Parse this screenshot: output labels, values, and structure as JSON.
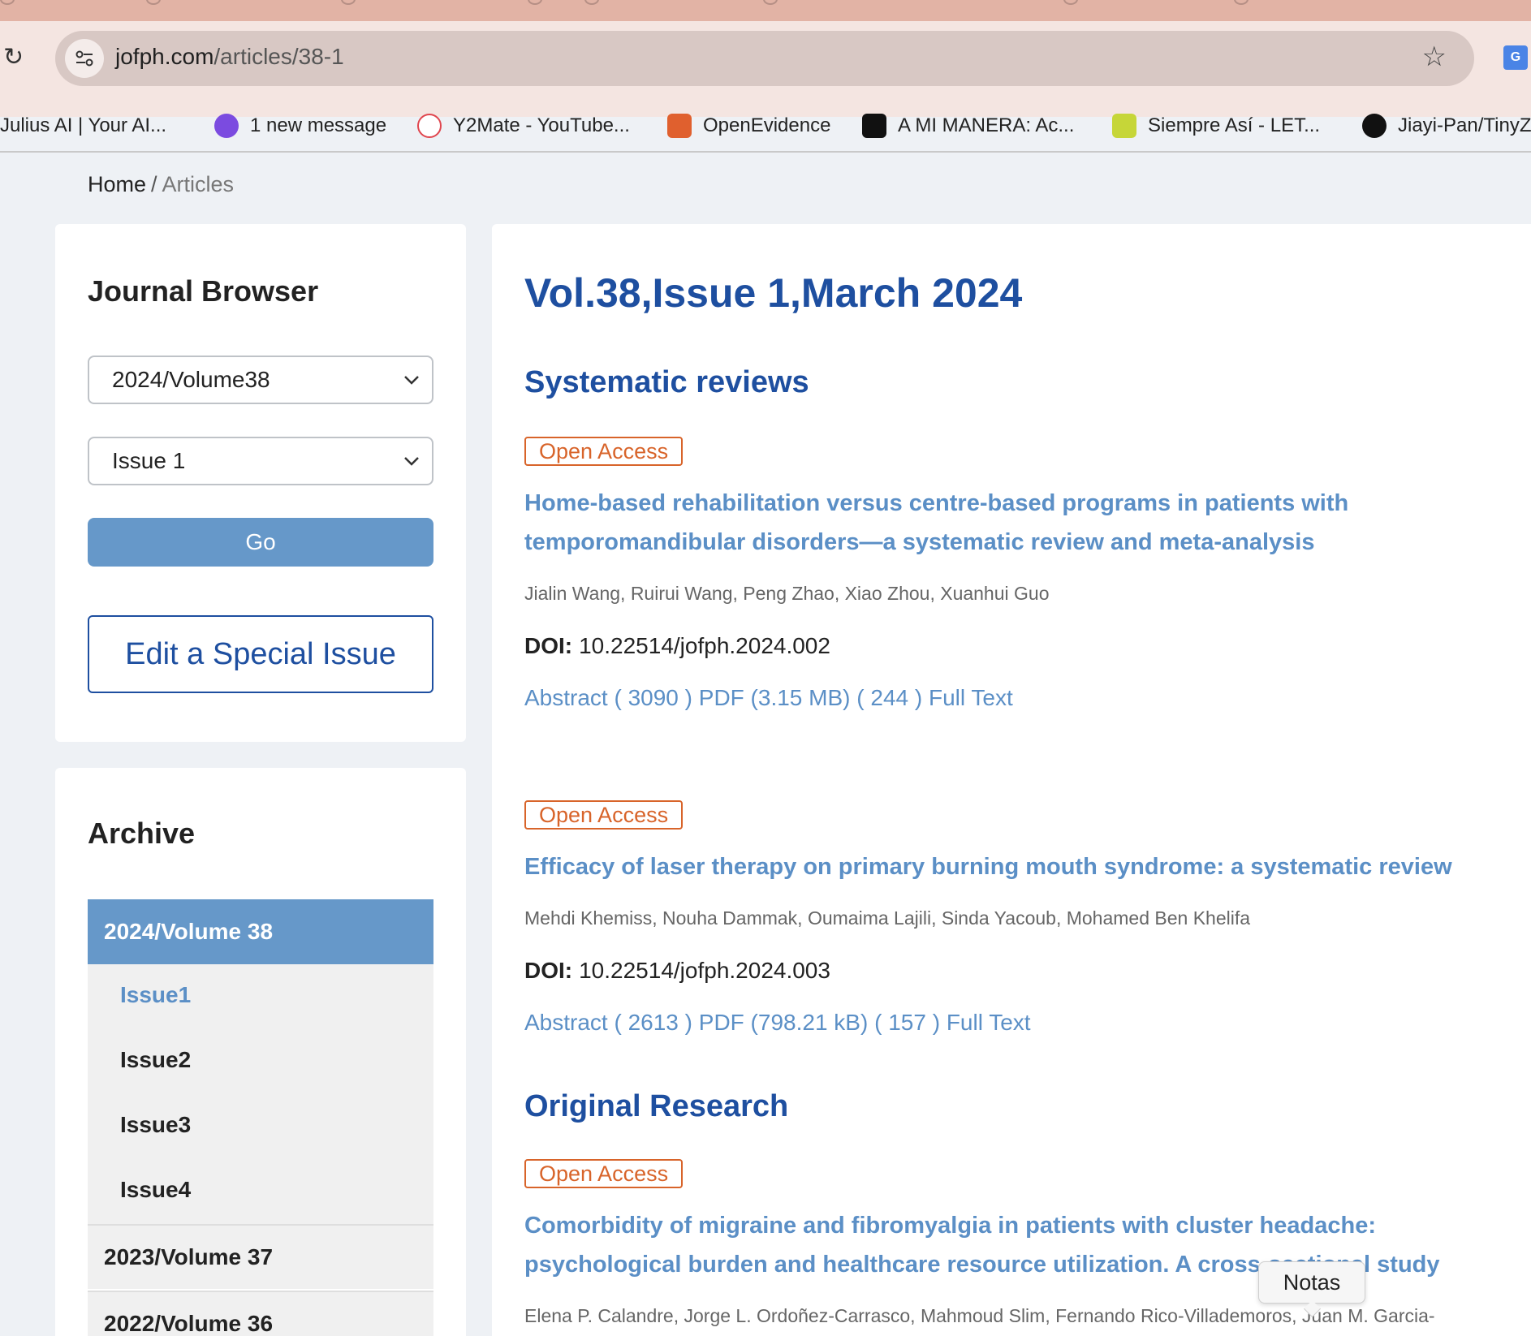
{
  "browser": {
    "url_host": "jofph.com",
    "url_path": "/articles/38-1",
    "bookmarks": [
      {
        "label": "Julius AI | Your AI...",
        "icon": "julius-icon"
      },
      {
        "label": "1 new message",
        "icon": "octopus-icon",
        "color": "#7b4be0"
      },
      {
        "label": "Y2Mate - YouTube...",
        "icon": "y2mate-icon",
        "color": "#e0464e"
      },
      {
        "label": "OpenEvidence",
        "icon": "openevidence-icon",
        "color": "#e0602e"
      },
      {
        "label": "A MI MANERA: Ac...",
        "icon": "lc-icon",
        "color": "#111111"
      },
      {
        "label": "Siempre Así - LET...",
        "icon": "star-badge-icon",
        "color": "#c6d638"
      },
      {
        "label": "Jiayi-Pan/TinyZ",
        "icon": "github-icon",
        "color": "#111111"
      }
    ]
  },
  "breadcrumb": {
    "home": "Home",
    "separator": "/",
    "current": "Articles"
  },
  "journal_browser": {
    "title": "Journal Browser",
    "volume_select": "2024/Volume38",
    "issue_select": "Issue 1",
    "go": "Go",
    "special_issue": "Edit a Special Issue"
  },
  "archive": {
    "title": "Archive",
    "active_volume": "2024/Volume 38",
    "issues": [
      "Issue1",
      "Issue2",
      "Issue3",
      "Issue4"
    ],
    "volumes": [
      "2023/Volume 37",
      "2022/Volume 36"
    ]
  },
  "main": {
    "heading": "Vol.38,Issue 1,March 2024",
    "sections": [
      "Systematic reviews",
      "Original Research"
    ],
    "open_access": "Open Access",
    "doi_label": "DOI:",
    "articles": [
      {
        "title": "Home-based rehabilitation versus centre-based programs in patients with temporomandibular disorders—a systematic review and meta-analysis",
        "authors": "Jialin Wang, Ruirui Wang, Peng Zhao, Xiao Zhou, Xuanhui Guo",
        "doi": "10.22514/jofph.2024.002",
        "abstract": "Abstract",
        "abstract_count": "3090",
        "pdf": "PDF (3.15 MB)",
        "pdf_count": "244",
        "full_text": "Full Text"
      },
      {
        "title": "Efficacy of laser therapy on primary burning mouth syndrome: a systematic review",
        "authors": "Mehdi Khemiss, Nouha Dammak, Oumaima Lajili, Sinda Yacoub, Mohamed Ben Khelifa",
        "doi": "10.22514/jofph.2024.003",
        "abstract": "Abstract",
        "abstract_count": "2613",
        "pdf": "PDF (798.21 kB)",
        "pdf_count": "157",
        "full_text": "Full Text"
      },
      {
        "title": "Comorbidity of migraine and fibromyalgia in patients with cluster headache: psychological burden and healthcare resource utilization. A cross-sectional study",
        "authors": "Elena P. Calandre, Jorge L. Ordoñez-Carrasco, Mahmoud Slim, Fernando Rico-Villademoros, Juan M. Garcia-"
      }
    ]
  },
  "tooltip": "Notas",
  "colors": {
    "accent": "#1e4fa0",
    "link": "#5b8fc6",
    "button": "#6698c9",
    "open_access": "#d8642a"
  }
}
